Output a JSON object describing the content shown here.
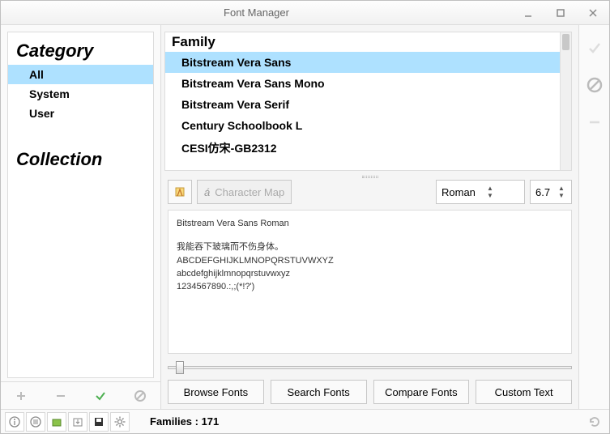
{
  "window": {
    "title": "Font Manager"
  },
  "sidebar": {
    "category_heading": "Category",
    "collection_heading": "Collection",
    "items": [
      {
        "label": "All",
        "selected": true
      },
      {
        "label": "System",
        "selected": false
      },
      {
        "label": "User",
        "selected": false
      }
    ]
  },
  "families": {
    "heading": "Family",
    "items": [
      {
        "label": "Bitstream Vera Sans",
        "selected": true
      },
      {
        "label": "Bitstream Vera Sans Mono",
        "selected": false
      },
      {
        "label": "Bitstream Vera Serif",
        "selected": false
      },
      {
        "label": "Century Schoolbook L",
        "selected": false
      },
      {
        "label": "CESI仿宋-GB2312",
        "selected": false
      }
    ]
  },
  "toolbar": {
    "charmap_label": "Character Map",
    "style_value": "Roman",
    "size_value": "6.7"
  },
  "preview": {
    "name": "Bitstream Vera Sans Roman",
    "lines": [
      "我能吞下玻璃而不伤身体。",
      "ABCDEFGHIJKLMNOPQRSTUVWXYZ",
      "abcdefghijklmnopqrstuvwxyz",
      "1234567890.:,;(*!?')"
    ]
  },
  "bottom": {
    "browse": "Browse Fonts",
    "search": "Search Fonts",
    "compare": "Compare Fonts",
    "custom": "Custom Text"
  },
  "status": {
    "families_label": "Families : 171"
  }
}
